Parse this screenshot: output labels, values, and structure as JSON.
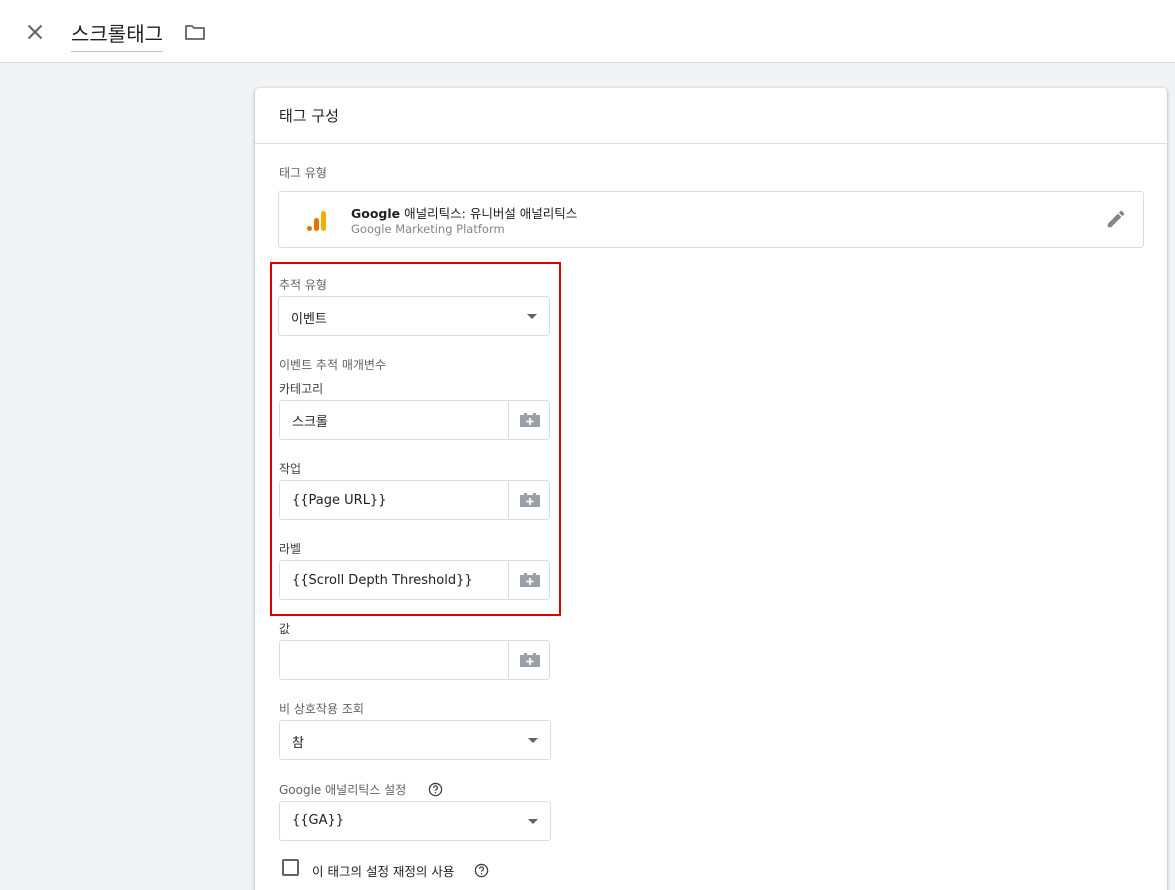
{
  "topbar": {
    "title": "스크롤태그",
    "close_icon": "close-icon",
    "folder_icon": "folder-icon"
  },
  "card": {
    "title": "태그 구성",
    "tag_type": {
      "label": "태그 유형",
      "brand": "Google",
      "name": "애널리틱스: 유니버설 애널리틱스",
      "subtitle": "Google Marketing Platform",
      "logo_icon": "google-analytics-logo-icon",
      "edit_icon": "pencil-edit-icon"
    },
    "tracking_type": {
      "label": "추적 유형",
      "value": "이벤트"
    },
    "event_params": {
      "label": "이벤트 추적 매개변수",
      "category": {
        "label": "카테고리",
        "value": "스크롤"
      },
      "action": {
        "label": "작업",
        "value": "{{Page URL}}"
      },
      "label_field": {
        "label": "라벨",
        "value": "{{Scroll Depth Threshold}}"
      },
      "value_field": {
        "label": "값",
        "value": ""
      }
    },
    "non_interaction": {
      "label": "비 상호작용 조회",
      "value": "참"
    },
    "ga_settings": {
      "label": "Google 애널리틱스 설정",
      "value": "{{GA}}"
    },
    "override": {
      "label": "이 태그의 설정 재정의 사용",
      "checked": false
    },
    "variable_icon": "add-variable-icon",
    "help_icon": "help-circle-icon"
  },
  "colors": {
    "highlight": "#e00000",
    "ga_orange": "#f9ab00",
    "ga_dark_orange": "#e37400"
  }
}
